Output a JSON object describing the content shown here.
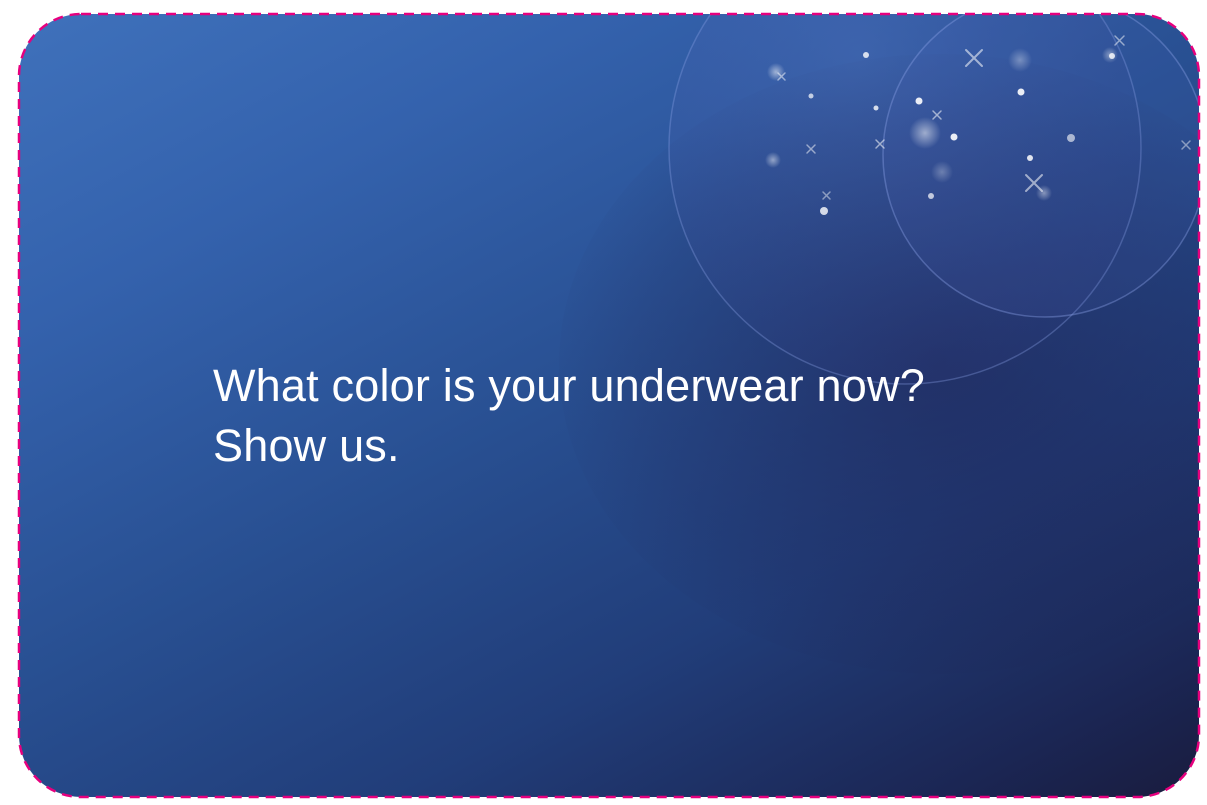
{
  "card": {
    "question_line1": "What color is your underwear now?",
    "question_line2": "Show us.",
    "border_color": "#e6007e",
    "gradient_start": "#3f71bb",
    "gradient_end": "#191c3e",
    "decoration": "bubbles-sparkles"
  }
}
